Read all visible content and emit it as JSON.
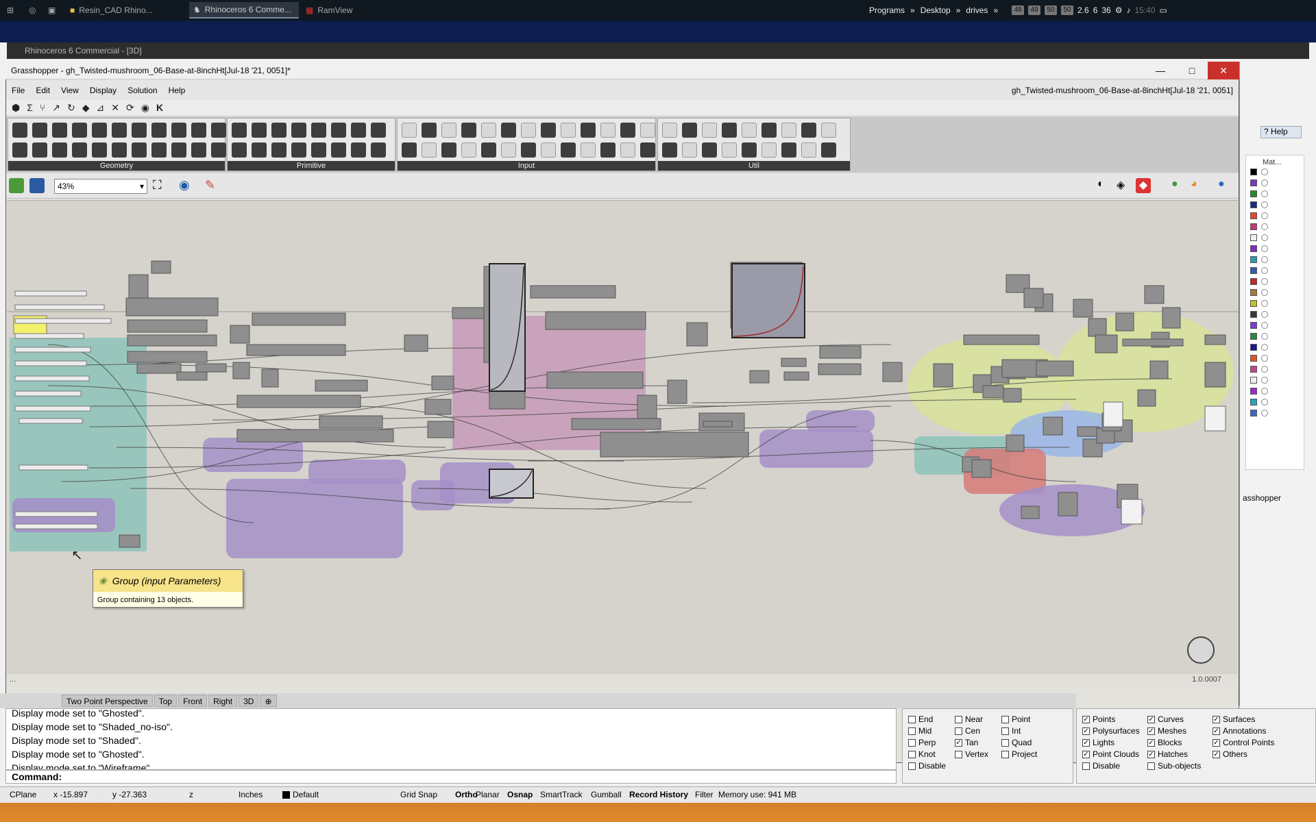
{
  "taskbar": {
    "start": "Start",
    "items": [
      {
        "label": "Resin_CAD Rhino...",
        "active": false
      },
      {
        "label": "Rhinoceros 6 Comme...",
        "active": true
      },
      {
        "label": "RamView",
        "active": false
      }
    ],
    "toolbars": [
      "Programs",
      "Desktop",
      "drives"
    ],
    "tray_numbers": [
      "48",
      "49",
      "50",
      "50",
      "2.6",
      "6",
      "36"
    ],
    "clock": "15:40"
  },
  "rhino": {
    "title": "Rhinoceros 6 Commercial - [3D]",
    "viewport_tabs": [
      "Two Point Perspective",
      "Top",
      "Front",
      "Right",
      "3D"
    ],
    "command_history": [
      "Display mode set to \"Ghosted\".",
      "Display mode set to \"Shaded_no-iso\".",
      "Display mode set to \"Shaded\".",
      "Display mode set to \"Ghosted\".",
      "Display mode set to \"Wireframe\"."
    ],
    "command_prompt": "Command:",
    "osnap": [
      {
        "label": "End",
        "checked": false
      },
      {
        "label": "Near",
        "checked": false
      },
      {
        "label": "Point",
        "checked": false
      },
      {
        "label": "Mid",
        "checked": false
      },
      {
        "label": "Cen",
        "checked": false
      },
      {
        "label": "Int",
        "checked": false
      },
      {
        "label": "Perp",
        "checked": false
      },
      {
        "label": "Tan",
        "checked": true
      },
      {
        "label": "Quad",
        "checked": false
      },
      {
        "label": "Knot",
        "checked": false
      },
      {
        "label": "Vertex",
        "checked": false
      },
      {
        "label": "Project",
        "checked": false
      },
      {
        "label": "Disable",
        "checked": false
      }
    ],
    "selection_filter": [
      {
        "label": "Points",
        "checked": true
      },
      {
        "label": "Curves",
        "checked": true
      },
      {
        "label": "Surfaces",
        "checked": true
      },
      {
        "label": "Polysurfaces",
        "checked": true
      },
      {
        "label": "Meshes",
        "checked": true
      },
      {
        "label": "Annotations",
        "checked": true
      },
      {
        "label": "Lights",
        "checked": true
      },
      {
        "label": "Blocks",
        "checked": true
      },
      {
        "label": "Control Points",
        "checked": true
      },
      {
        "label": "Point Clouds",
        "checked": true
      },
      {
        "label": "Hatches",
        "checked": true
      },
      {
        "label": "Others",
        "checked": true
      },
      {
        "label": "Disable",
        "checked": false
      },
      {
        "label": "Sub-objects",
        "checked": false
      }
    ],
    "statusbar": {
      "cplane": "CPlane",
      "x": "x -15.897",
      "y": "y -27.363",
      "z": "z",
      "units": "Inches",
      "layer": "Default",
      "toggles": [
        "Grid Snap",
        "Ortho",
        "Planar",
        "Osnap",
        "SmartTrack",
        "Gumball",
        "Record History",
        "Filter"
      ],
      "bold_toggles": [
        "Ortho",
        "Osnap",
        "Record History"
      ],
      "memory": "Memory use: 941 MB"
    },
    "side_panel": {
      "tab": "Help",
      "column": "Mat...",
      "footer": "asshopper"
    }
  },
  "gh": {
    "title": "Grasshopper - gh_Twisted-mushroom_06-Base-at-8inchHt[Jul-18 '21, 0051]*",
    "doc_name": "gh_Twisted-mushroom_06-Base-at-8inchHt[Jul-18 '21, 0051]",
    "menu": [
      "File",
      "Edit",
      "View",
      "Display",
      "Solution",
      "Help"
    ],
    "tab_icons": [
      "Params",
      "Maths",
      "Sets",
      "Vector",
      "Curve",
      "Surface",
      "Mesh",
      "Intersect",
      "Transform",
      "Display",
      "Kangaroo"
    ],
    "panels": [
      "Geometry",
      "Primitive",
      "Input",
      "Util"
    ],
    "zoom": "43%",
    "version": "1.0.0007",
    "status_left": "...",
    "tooltip": {
      "title": "Group (input Parameters)",
      "body": "Group containing 13 objects."
    },
    "panel_colors": {
      "geometry": "#3d3d3d",
      "group_teal": "#8ec3b9",
      "group_purple": "#a58fc8",
      "group_pink": "#c79ab8",
      "group_lime": "#d8e29a",
      "group_blue": "#9ab6e8",
      "group_red": "#d67a78",
      "selection_yellow": "#f4f26a"
    }
  }
}
